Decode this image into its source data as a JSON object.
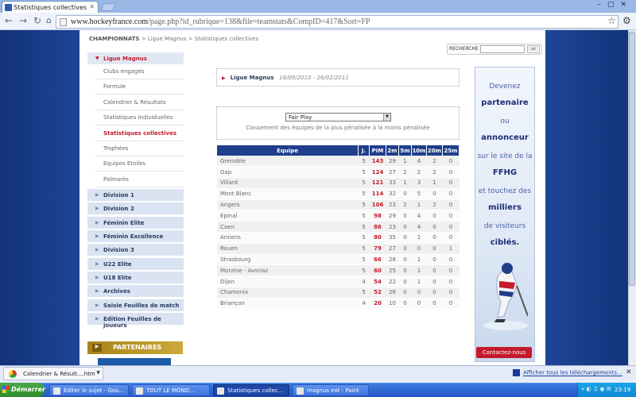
{
  "browser": {
    "tab_title": "Statistiques collectives",
    "url_domain": "www.hockeyfrance.com",
    "url_path": "/page.php?id_rubrique=138&file=teamstats&CompID=417&Sort=FP"
  },
  "page": {
    "breadcrumb_root": "CHAMPIONNATS",
    "breadcrumb_rest": " > Ligue Magnus > Statistiques collectives",
    "search_label": "RECHERCHE",
    "search_button": "ok"
  },
  "menu": {
    "section": "Ligue Magnus",
    "subitems": [
      "Clubs engagés",
      "Formule",
      "Calendrier & Résultats",
      "Statistiques individuelles",
      "Statistiques collectives",
      "Trophées",
      "Equipes Etoiles",
      "Palmarès"
    ],
    "active_subitem": "Statistiques collectives",
    "items": [
      "Division 1",
      "Division 2",
      "Féminin Elite",
      "Féminin Excellence",
      "Division 3",
      "U22 Elite",
      "U18 Elite",
      "Archives",
      "Saisie Feuilles de match",
      "Edition Feuilles de joueurs"
    ],
    "partners": "PARTENAIRES"
  },
  "competition": {
    "name": "Ligue Magnus",
    "dates": "18/09/2010 - 26/02/2011"
  },
  "sort": {
    "selected": "Fair Play",
    "caption": "Classement des équipes de la plus pénalisée à la moins pénalisée"
  },
  "table": {
    "headers": [
      "Equipe",
      "J.",
      "PIM",
      "2m",
      "5m",
      "10m",
      "20m",
      "25m"
    ],
    "rows": [
      [
        "Grenoble",
        "5",
        "143",
        "29",
        "1",
        "4",
        "2",
        "0"
      ],
      [
        "Gap",
        "5",
        "124",
        "27",
        "2",
        "2",
        "2",
        "0"
      ],
      [
        "Villard",
        "5",
        "121",
        "33",
        "1",
        "3",
        "1",
        "0"
      ],
      [
        "Mont Blanc",
        "5",
        "114",
        "32",
        "0",
        "5",
        "0",
        "0"
      ],
      [
        "Angers",
        "5",
        "106",
        "23",
        "2",
        "1",
        "2",
        "0"
      ],
      [
        "Epinal",
        "5",
        "98",
        "29",
        "0",
        "4",
        "0",
        "0"
      ],
      [
        "Caen",
        "5",
        "86",
        "23",
        "0",
        "4",
        "0",
        "0"
      ],
      [
        "Amiens",
        "5",
        "80",
        "35",
        "0",
        "1",
        "0",
        "0"
      ],
      [
        "Rouen",
        "5",
        "79",
        "27",
        "0",
        "0",
        "0",
        "1"
      ],
      [
        "Strasbourg",
        "5",
        "66",
        "28",
        "0",
        "1",
        "0",
        "0"
      ],
      [
        "Morzine - Avoriaz",
        "5",
        "60",
        "25",
        "0",
        "1",
        "0",
        "0"
      ],
      [
        "Dijon",
        "4",
        "54",
        "22",
        "0",
        "1",
        "0",
        "0"
      ],
      [
        "Chamonix",
        "5",
        "52",
        "26",
        "0",
        "0",
        "0",
        "0"
      ],
      [
        "Briançon",
        "4",
        "20",
        "10",
        "0",
        "0",
        "0",
        "0"
      ]
    ]
  },
  "ad": {
    "lines": [
      "Devenez",
      "partenaire",
      "ou",
      "annonceur",
      "sur le site de la",
      "FFHG",
      "et touchez des",
      "milliers",
      "de visiteurs",
      "ciblés."
    ],
    "button": "Contactez-nous"
  },
  "downloads": {
    "file": "Calendrier & Résult....htm",
    "show_all": "Afficher tous les téléchargements..."
  },
  "taskbar": {
    "start": "Démarrer",
    "items": [
      "Editer le sujet - Goo...",
      "TOUT LE MOND...",
      "Statistiques collec...",
      "magnus ext - Paint"
    ],
    "clock": "23:19"
  },
  "colors": {
    "accent": "#c41a2c",
    "navy": "#1f3e8c",
    "brand_gold": "#b8951f"
  }
}
